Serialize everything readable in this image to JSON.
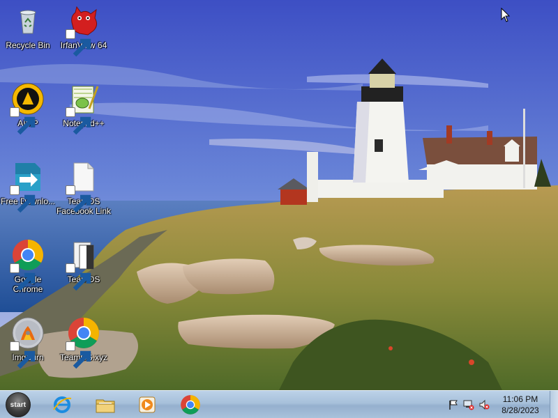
{
  "desktop": {
    "icons": [
      {
        "name": "recycle-bin",
        "label": "Recycle Bin",
        "icon": "recycle-bin-icon",
        "shortcut": false
      },
      {
        "name": "irfanview",
        "label": "IrfanView 64",
        "icon": "irfanview-cat-icon",
        "shortcut": true
      },
      {
        "name": "aimp",
        "label": "AIMP",
        "icon": "aimp-icon",
        "shortcut": true
      },
      {
        "name": "notepadpp",
        "label": "Notepad++",
        "icon": "notepadpp-icon",
        "shortcut": true
      },
      {
        "name": "free-download",
        "label": "Free Downlo...",
        "icon": "free-download-manager-icon",
        "shortcut": true
      },
      {
        "name": "teamos-facebook",
        "label": "TeamOS Facebook Link",
        "icon": "blank-file-icon",
        "shortcut": true
      },
      {
        "name": "google-chrome",
        "label": "Google Chrome",
        "icon": "chrome-icon",
        "shortcut": true
      },
      {
        "name": "teamos",
        "label": "TeamOS",
        "icon": "window-document-icon",
        "shortcut": true
      },
      {
        "name": "imgburn",
        "label": "ImgBurn",
        "icon": "imgburn-disc-icon",
        "shortcut": true
      },
      {
        "name": "teamos-xyz",
        "label": "TeamOS.xyz",
        "icon": "chrome-icon",
        "shortcut": true
      }
    ]
  },
  "taskbar": {
    "start_label": "start",
    "pinned": [
      {
        "name": "internet-explorer",
        "icon": "internet-explorer-icon"
      },
      {
        "name": "file-explorer",
        "icon": "folder-icon"
      },
      {
        "name": "media-player",
        "icon": "media-player-icon"
      },
      {
        "name": "chrome",
        "icon": "chrome-icon"
      }
    ],
    "tray": {
      "icons": [
        "action-center-flag-icon",
        "network-icon",
        "volume-muted-icon"
      ],
      "time": "11:06 PM",
      "date": "8/28/2023"
    }
  },
  "colors": {
    "sky_top": "#4a5fc8",
    "sea": "#3b6ab0",
    "taskbar": "#a9c2db",
    "chrome_red": "#db4437",
    "chrome_green": "#0f9d58",
    "chrome_yellow": "#f4b400",
    "chrome_blue": "#4285f4"
  }
}
